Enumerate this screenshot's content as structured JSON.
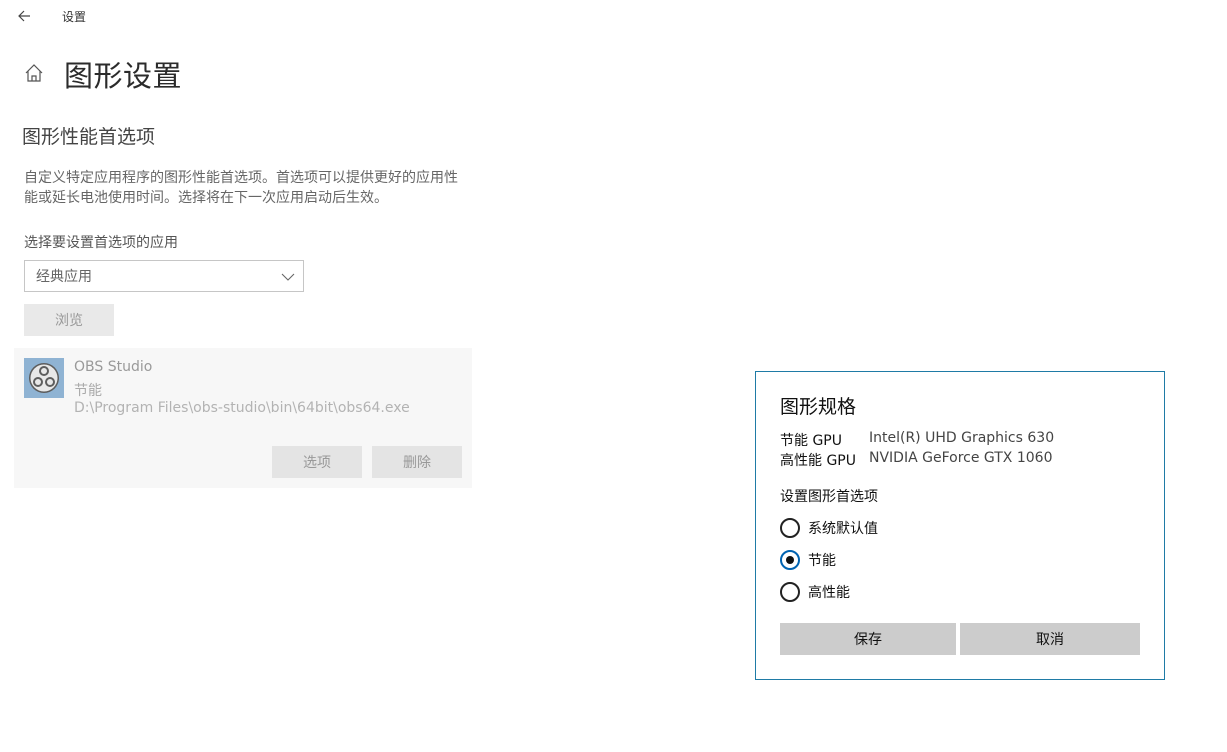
{
  "window": {
    "title": "设置",
    "back_icon": "back-arrow-icon"
  },
  "header": {
    "home_icon": "home-icon",
    "page_title": "图形设置"
  },
  "section": {
    "title": "图形性能首选项",
    "description": "自定义特定应用程序的图形性能首选项。首选项可以提供更好的应用性能或延长电池使用时间。选择将在下一次应用启动后生效。",
    "select_label": "选择要设置首选项的应用",
    "dropdown_value": "经典应用",
    "browse_label": "浏览"
  },
  "app_card": {
    "name": "OBS Studio",
    "preference": "节能",
    "path": "D:\\Program Files\\obs-studio\\bin\\64bit\\obs64.exe",
    "options_label": "选项",
    "delete_label": "删除"
  },
  "dialog": {
    "title": "图形规格",
    "specs": [
      {
        "label": "节能 GPU",
        "value": "Intel(R) UHD Graphics 630"
      },
      {
        "label": "高性能 GPU",
        "value": "NVIDIA GeForce GTX 1060"
      }
    ],
    "pref_label": "设置图形首选项",
    "options": [
      {
        "label": "系统默认值",
        "checked": false
      },
      {
        "label": "节能",
        "checked": true
      },
      {
        "label": "高性能",
        "checked": false
      }
    ],
    "save_label": "保存",
    "cancel_label": "取消"
  },
  "colors": {
    "accent": "#0063b1",
    "dialog_border": "#1f7ba6",
    "app_icon_bg": "#8fb3d3"
  }
}
